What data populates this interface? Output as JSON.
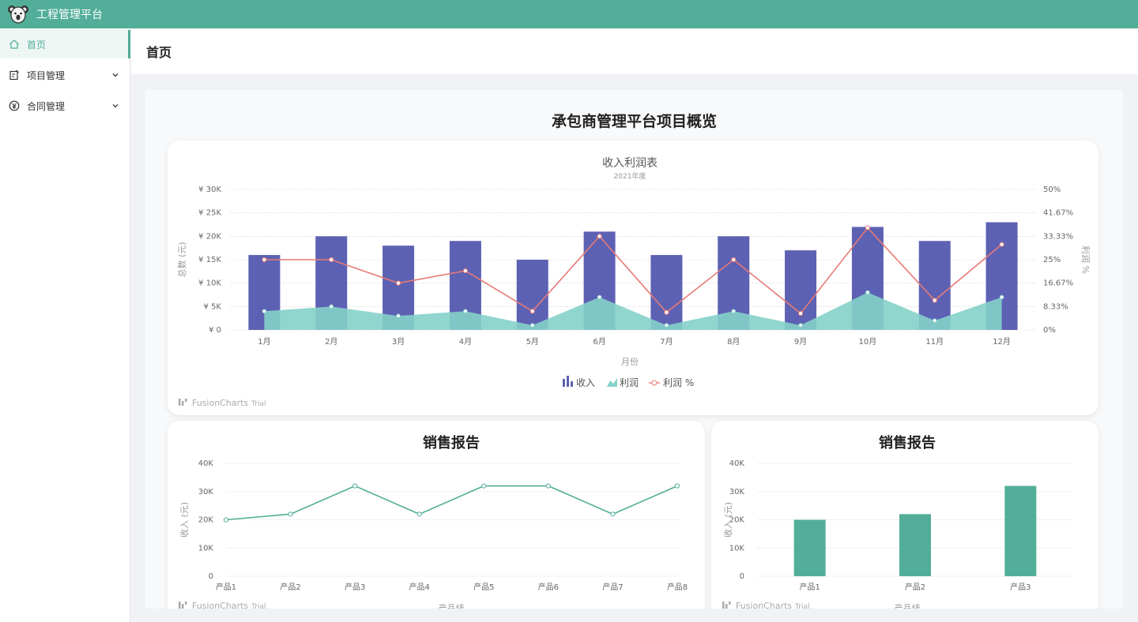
{
  "app": {
    "title": "工程管理平台",
    "logo_icon": "koala-icon"
  },
  "colors": {
    "brand": "#52ae98",
    "revenue": "#5d61b3",
    "profit": "#85d1c9",
    "profit_pct": "#e87a76"
  },
  "sidebar": {
    "items": [
      {
        "label": "首页",
        "icon": "home-icon",
        "active": true
      },
      {
        "label": "项目管理",
        "icon": "project-icon",
        "expandable": true
      },
      {
        "label": "合同管理",
        "icon": "yuan-icon",
        "expandable": true
      }
    ]
  },
  "page": {
    "title": "首页"
  },
  "dashboard": {
    "title": "承包商管理平台项目概览"
  },
  "chart_data": [
    {
      "type": "bar",
      "title": "收入利润表",
      "subtitle": "2021年度",
      "xlabel": "月份",
      "ylabel": "总数 (元)",
      "y2label": "利润 %",
      "categories": [
        "1月",
        "2月",
        "3月",
        "4月",
        "5月",
        "6月",
        "7月",
        "8月",
        "9月",
        "10月",
        "11月",
        "12月"
      ],
      "series": [
        {
          "name": "收入",
          "type": "bar",
          "values": [
            16000,
            20000,
            18000,
            19000,
            15000,
            21000,
            16000,
            20000,
            17000,
            22000,
            19000,
            23000
          ]
        },
        {
          "name": "利润",
          "type": "area",
          "values": [
            4000,
            5000,
            3000,
            4000,
            1000,
            7000,
            1000,
            4000,
            1000,
            8000,
            2000,
            7000
          ]
        },
        {
          "name": "利润 %",
          "type": "line",
          "axis": "secondary",
          "values": [
            25,
            25,
            16.67,
            21.05,
            6.67,
            33.33,
            6.25,
            25,
            5.88,
            36.36,
            10.53,
            30.43
          ]
        }
      ],
      "ylim": [
        0,
        30000
      ],
      "y_ticks": [
        "¥ 0",
        "¥ 5K",
        "¥ 10K",
        "¥ 15K",
        "¥ 20K",
        "¥ 25K",
        "¥ 30K"
      ],
      "y2lim": [
        0,
        50
      ],
      "y2_ticks": [
        "0%",
        "8.33%",
        "16.67%",
        "25%",
        "33.33%",
        "41.67%",
        "50%"
      ],
      "legend_position": "bottom",
      "grid": true,
      "watermark": {
        "brand": "FusionCharts",
        "suffix": "Trial"
      }
    },
    {
      "type": "line",
      "title": "销售报告",
      "xlabel": "产品线",
      "ylabel": "收入 (元)",
      "categories": [
        "产品1",
        "产品2",
        "产品3",
        "产品4",
        "产品5",
        "产品6",
        "产品7",
        "产品8"
      ],
      "values": [
        20000,
        22000,
        32000,
        22000,
        32000,
        32000,
        22000,
        32000
      ],
      "ylim": [
        0,
        40000
      ],
      "y_ticks": [
        "0",
        "10K",
        "20K",
        "30K",
        "40K"
      ],
      "grid": true,
      "watermark": {
        "brand": "FusionCharts",
        "suffix": "Trial"
      }
    },
    {
      "type": "bar",
      "title": "销售报告",
      "xlabel": "产品线",
      "ylabel": "收入 (元)",
      "categories": [
        "产品1",
        "产品2",
        "产品3"
      ],
      "values": [
        20000,
        22000,
        32000
      ],
      "ylim": [
        0,
        40000
      ],
      "y_ticks": [
        "0",
        "10K",
        "20K",
        "30K",
        "40K"
      ],
      "grid": true,
      "watermark": {
        "brand": "FusionCharts",
        "suffix": "Trial"
      }
    }
  ]
}
